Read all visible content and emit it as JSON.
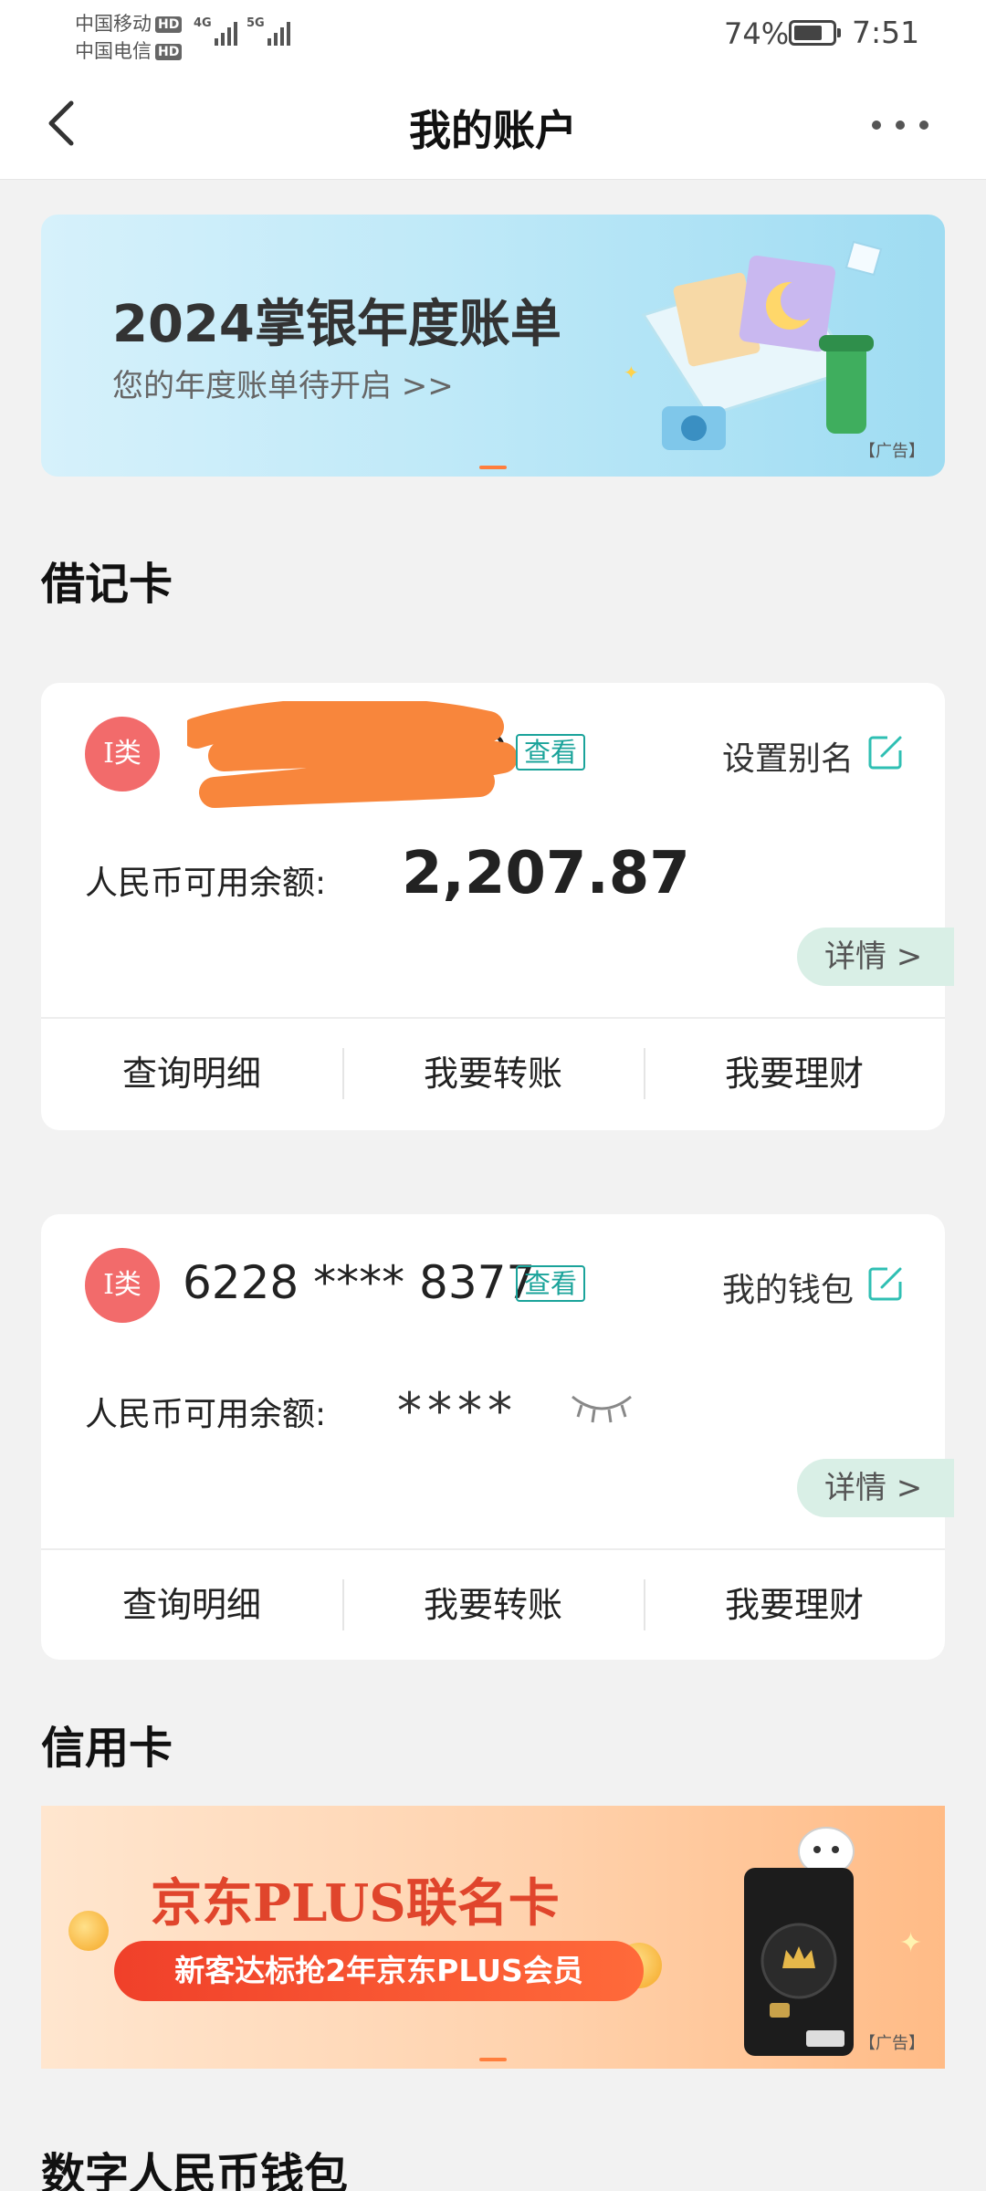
{
  "status_bar": {
    "carrier1": "中国移动",
    "carrier2": "中国电信",
    "hd": "HD",
    "net1": "4G",
    "net2": "5G",
    "battery_pct": "74%",
    "battery_level": 0.74,
    "time": "7:51"
  },
  "nav": {
    "title": "我的账户"
  },
  "banner": {
    "title": "2024掌银年度账单",
    "subtitle": "您的年度账单待开启 >>",
    "ad_tag": "【广告】"
  },
  "debit": {
    "section_title": "借记卡",
    "cards": [
      {
        "type": "I类",
        "number_visible": "9",
        "view_label": "查看",
        "alias": "设置别名",
        "balance_label": "人民币可用余额:",
        "balance": "2,207.87",
        "detail_label": "详情 >",
        "actions": [
          "查询明细",
          "我要转账",
          "我要理财"
        ]
      },
      {
        "type": "I类",
        "number": "6228 **** 8377",
        "view_label": "查看",
        "alias": "我的钱包",
        "balance_label": "人民币可用余额:",
        "balance_masked": "****",
        "detail_label": "详情 >",
        "actions": [
          "查询明细",
          "我要转账",
          "我要理财"
        ]
      }
    ]
  },
  "credit": {
    "section_title": "信用卡",
    "banner_title": "京东PLUS联名卡",
    "banner_pill": "新客达标抢2年京东PLUS会员",
    "ad_tag": "【广告】"
  },
  "digital": {
    "section_title": "数字人民币钱包"
  },
  "colors": {
    "accent_teal": "#1aa39a",
    "badge_red": "#f26b6b",
    "promo_red": "#e0452c"
  }
}
